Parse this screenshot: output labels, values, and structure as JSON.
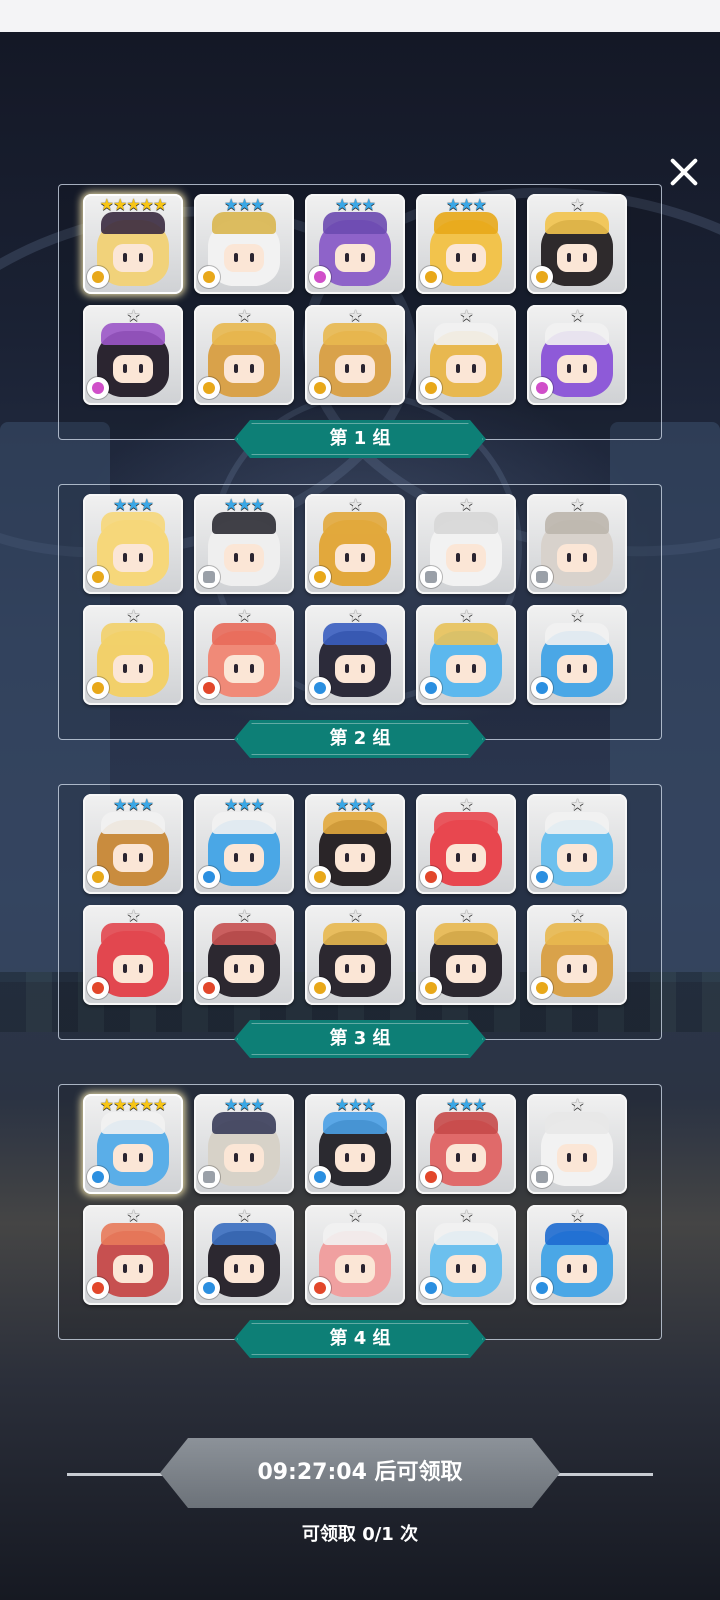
{
  "close": {
    "icon": "close-icon"
  },
  "groups": [
    {
      "label": "第 1 组",
      "heroes": [
        {
          "stars": "★★★★★",
          "tier": "gold",
          "element": "wind",
          "hair": "#f1d27a",
          "hat": "#3a2a40",
          "glow": true
        },
        {
          "stars": "★★★",
          "tier": "blue",
          "element": "wind",
          "hair": "#f2f2f2",
          "hat": "#d9b64f"
        },
        {
          "stars": "★★★",
          "tier": "blue",
          "element": "dark",
          "hair": "#8e63c9",
          "hat": "#6b4ab0"
        },
        {
          "stars": "★★★",
          "tier": "blue",
          "element": "wind",
          "hair": "#f2c34c",
          "hat": "#e8a81a"
        },
        {
          "stars": "★",
          "tier": "silver",
          "element": "wind",
          "hair": "#2e2a2c",
          "hat": "#f2c34c"
        },
        {
          "stars": "★",
          "tier": "silver",
          "element": "dark",
          "hair": "#2b2530",
          "hat": "#9b56c8"
        },
        {
          "stars": "★",
          "tier": "silver",
          "element": "wind",
          "hair": "#d9a24a",
          "hat": "#e8b84f"
        },
        {
          "stars": "★",
          "tier": "silver",
          "element": "wind",
          "hair": "#d9a24a",
          "hat": "#e8b84f"
        },
        {
          "stars": "★",
          "tier": "silver",
          "element": "wind",
          "hair": "#e8b84f",
          "hat": "#f2f2f2"
        },
        {
          "stars": "★",
          "tier": "silver",
          "element": "dark",
          "hair": "#8e5ad8",
          "hat": "#f2f2f2"
        }
      ]
    },
    {
      "label": "第 2 组",
      "heroes": [
        {
          "stars": "★★★",
          "tier": "blue",
          "element": "wind",
          "hair": "#f6d77a",
          "hat": "#f6d77a"
        },
        {
          "stars": "★★★",
          "tier": "blue",
          "element": "light",
          "hair": "#efefef",
          "hat": "#2c2c34"
        },
        {
          "stars": "★",
          "tier": "silver",
          "element": "wind",
          "hair": "#e2a83c",
          "hat": "#e2a83c"
        },
        {
          "stars": "★",
          "tier": "silver",
          "element": "light",
          "hair": "#f2f2f2",
          "hat": "#d7d7d7"
        },
        {
          "stars": "★",
          "tier": "silver",
          "element": "light",
          "hair": "#d8d2cc",
          "hat": "#bdb6ad"
        },
        {
          "stars": "★",
          "tier": "silver",
          "element": "wind",
          "hair": "#f2d06a",
          "hat": "#f2d06a"
        },
        {
          "stars": "★",
          "tier": "silver",
          "element": "fire",
          "hair": "#f08a78",
          "hat": "#e86a5a"
        },
        {
          "stars": "★",
          "tier": "silver",
          "element": "water",
          "hair": "#2c2b3a",
          "hat": "#3a5ec0"
        },
        {
          "stars": "★",
          "tier": "silver",
          "element": "water",
          "hair": "#5cb8ee",
          "hat": "#e8c25a"
        },
        {
          "stars": "★",
          "tier": "silver",
          "element": "water",
          "hair": "#4aa7e6",
          "hat": "#f2f2f2"
        }
      ]
    },
    {
      "label": "第 3 组",
      "heroes": [
        {
          "stars": "★★★",
          "tier": "blue",
          "element": "wind",
          "hair": "#c98c3e",
          "hat": "#f2f2f2"
        },
        {
          "stars": "★★★",
          "tier": "blue",
          "element": "water",
          "hair": "#4aa7e6",
          "hat": "#f2f2f2"
        },
        {
          "stars": "★★★",
          "tier": "blue",
          "element": "wind",
          "hair": "#2a2528",
          "hat": "#e2a83c"
        },
        {
          "stars": "★",
          "tier": "silver",
          "element": "fire",
          "hair": "#e8474f",
          "hat": "#e8474f"
        },
        {
          "stars": "★",
          "tier": "silver",
          "element": "water",
          "hair": "#6cc0ee",
          "hat": "#f2f2f2"
        },
        {
          "stars": "★",
          "tier": "silver",
          "element": "fire",
          "hair": "#e2474f",
          "hat": "#e2474f"
        },
        {
          "stars": "★",
          "tier": "silver",
          "element": "fire",
          "hair": "#2c2830",
          "hat": "#c75050"
        },
        {
          "stars": "★",
          "tier": "silver",
          "element": "wind",
          "hair": "#2c2830",
          "hat": "#e8b84f"
        },
        {
          "stars": "★",
          "tier": "silver",
          "element": "wind",
          "hair": "#2c2830",
          "hat": "#e8b84f"
        },
        {
          "stars": "★",
          "tier": "silver",
          "element": "wind",
          "hair": "#d9a24a",
          "hat": "#e8b84f"
        }
      ]
    },
    {
      "label": "第 4 组",
      "heroes": [
        {
          "stars": "★★★★★",
          "tier": "gold",
          "element": "water",
          "hair": "#5aaee8",
          "hat": "#f2f2f2",
          "glow": true
        },
        {
          "stars": "★★★",
          "tier": "blue",
          "element": "light",
          "hair": "#d7d2c8",
          "hat": "#3a3d5a"
        },
        {
          "stars": "★★★",
          "tier": "blue",
          "element": "water",
          "hair": "#2b2a30",
          "hat": "#4aa0e6"
        },
        {
          "stars": "★★★",
          "tier": "blue",
          "element": "fire",
          "hair": "#e06a6a",
          "hat": "#c74a4a"
        },
        {
          "stars": "★",
          "tier": "silver",
          "element": "light",
          "hair": "#f2f2f2",
          "hat": "#e8e8e8"
        },
        {
          "stars": "★",
          "tier": "silver",
          "element": "fire",
          "hair": "#c75050",
          "hat": "#e87a5a"
        },
        {
          "stars": "★",
          "tier": "silver",
          "element": "water",
          "hair": "#2c2830",
          "hat": "#3a6ec0"
        },
        {
          "stars": "★",
          "tier": "silver",
          "element": "fire",
          "hair": "#f0a0a0",
          "hat": "#f2f2f2"
        },
        {
          "stars": "★",
          "tier": "silver",
          "element": "water",
          "hair": "#6cc0ee",
          "hat": "#f2f2f2"
        },
        {
          "stars": "★",
          "tier": "silver",
          "element": "water",
          "hair": "#4aa7e6",
          "hat": "#1e6bd0"
        }
      ]
    }
  ],
  "claim": {
    "button_label": "09:27:04 后可领取",
    "count_text": "可领取 0/1 次"
  }
}
